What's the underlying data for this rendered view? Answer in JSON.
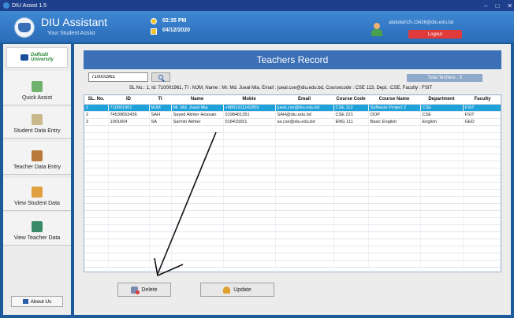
{
  "window": {
    "title": "DIU Assist 1.5"
  },
  "header": {
    "app_title": "DIU Assistant",
    "app_subtitle": "Your Student Assist",
    "time": "02:35 PM",
    "date": "04/12/2020",
    "user_email": "abdullah15-13426@diu.edu.bd",
    "logout_label": "Logout"
  },
  "sidebar": {
    "logo_text_1": "Daffodil",
    "logo_text_2": "University",
    "items": [
      {
        "label": "Quick Assist"
      },
      {
        "label": "Student Data Entry"
      },
      {
        "label": "Teacher Data Entry"
      },
      {
        "label": "View Student Data"
      },
      {
        "label": "View Teacher Data"
      }
    ],
    "about_label": "About Us"
  },
  "main": {
    "banner_title": "Teachers Record",
    "search_value": "710001961",
    "total_label": "Total Techers : 3",
    "detail_line": "SL No.: 1, Id: 710001961, TI : MJM, Name : Mr. Md. Jueal Mia, Email : jueal.cse@diu.edu.bd, Coursecode : CSE 113, Dept. :CSE, Faculty : FSIT",
    "table": {
      "headers": [
        "SL. No.",
        "ID",
        "TI",
        "Name",
        "Mobie",
        "Email",
        "Course Code",
        "Course Name",
        "Department",
        "Faculty"
      ],
      "rows": [
        [
          "1",
          "710001961",
          "MJM",
          "Mr. Md. Jueal Mia",
          "+8801911142859",
          "jueal.cse@diu.edu.bd",
          "CSE 113",
          "Software Project 2",
          "CSE",
          "FSIT"
        ],
        [
          "2",
          "74539653436",
          "SAH",
          "Sayed Akhter Hossain",
          "0198461351",
          "SAH@diu.edu.bd",
          "CSE 221",
          "OOP",
          "CSE",
          "FSIT"
        ],
        [
          "3",
          "1001664",
          "SA",
          "Sarmin Akhter",
          "018415651",
          "sa.cse@diu.edu.bd",
          "ENG 111",
          "Basic English",
          "English",
          "GED"
        ]
      ]
    },
    "delete_label": "Delete",
    "update_label": "Update"
  },
  "colors": {
    "accent": "#1fa1d9",
    "banner": "#3b6fb6",
    "logout": "#e03a3a"
  }
}
